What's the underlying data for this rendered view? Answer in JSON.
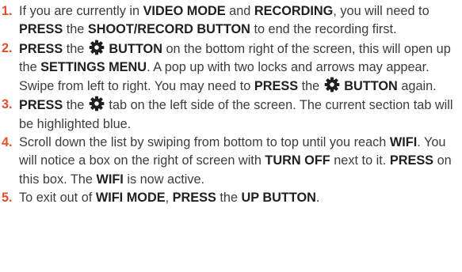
{
  "accent_color": "#e0512b",
  "steps": [
    {
      "number": "1.",
      "segments": [
        {
          "text": "If you are currently in ",
          "bold": false
        },
        {
          "text": "VIDEO MODE",
          "bold": true
        },
        {
          "text": " and ",
          "bold": false
        },
        {
          "text": "RECORDING",
          "bold": true
        },
        {
          "text": ", you will need to ",
          "bold": false
        },
        {
          "text": "PRESS",
          "bold": true
        },
        {
          "text": " the ",
          "bold": false
        },
        {
          "text": "SHOOT/RECORD BUTTON",
          "bold": true
        },
        {
          "text": " to end the recording first.",
          "bold": false
        }
      ]
    },
    {
      "number": "2.",
      "segments": [
        {
          "text": "PRESS",
          "bold": true
        },
        {
          "text": " the ",
          "bold": false
        },
        {
          "icon": "gear-icon"
        },
        {
          "text": " BUTTON",
          "bold": true
        },
        {
          "text": " on the bottom right of the screen, this will open up the ",
          "bold": false
        },
        {
          "text": "SETTINGS MENU",
          "bold": true
        },
        {
          "text": ". A pop up with two locks and arrows may appear. Swipe from left to right. You may need to ",
          "bold": false
        },
        {
          "text": "PRESS",
          "bold": true
        },
        {
          "text": " the ",
          "bold": false
        },
        {
          "icon": "gear-icon"
        },
        {
          "text": " BUTTON",
          "bold": true
        },
        {
          "text": " again.",
          "bold": false
        }
      ]
    },
    {
      "number": "3.",
      "segments": [
        {
          "text": "PRESS",
          "bold": true
        },
        {
          "text": " the ",
          "bold": false
        },
        {
          "icon": "gear-icon"
        },
        {
          "text": " tab on the left side of the screen. The current section tab will be highlighted blue.",
          "bold": false
        }
      ]
    },
    {
      "number": "4.",
      "segments": [
        {
          "text": "Scroll down the list  by swiping from bottom to top until you reach ",
          "bold": false
        },
        {
          "text": "WIFI",
          "bold": true
        },
        {
          "text": ". You will notice a box on the right of screen with ",
          "bold": false
        },
        {
          "text": "TURN OFF",
          "bold": true
        },
        {
          "text": " next to it. ",
          "bold": false
        },
        {
          "text": "PRESS",
          "bold": true
        },
        {
          "text": " on this box. The ",
          "bold": false
        },
        {
          "text": "WIFI",
          "bold": true
        },
        {
          "text": " is now active.",
          "bold": false
        }
      ]
    },
    {
      "number": "5.",
      "segments": [
        {
          "text": "To exit out of ",
          "bold": false
        },
        {
          "text": "WIFI MODE",
          "bold": true
        },
        {
          "text": ", ",
          "bold": false
        },
        {
          "text": "PRESS",
          "bold": true
        },
        {
          "text": " the ",
          "bold": false
        },
        {
          "text": "UP BUTTON",
          "bold": true
        },
        {
          "text": ".",
          "bold": false
        }
      ]
    }
  ]
}
